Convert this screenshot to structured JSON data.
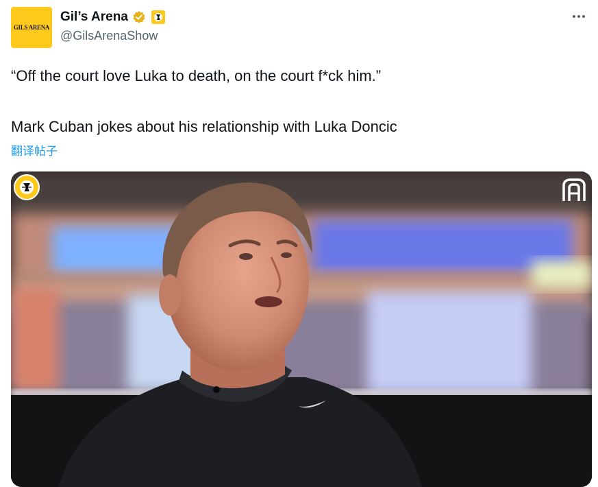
{
  "account": {
    "display_name": "Gil’s Arena",
    "handle": "@GilsArenaShow",
    "avatar_text": "GILS ARENA",
    "verified_color": "#e8b21c",
    "affiliate_badge": "gils-arena-badge-icon"
  },
  "tweet": {
    "quote": "“Off the court love Luka to death, on the court f*ck him.”",
    "body": "Mark Cuban jokes about his relationship with Luka Doncic",
    "translate_label": "翻译帖子"
  },
  "media": {
    "type": "video-thumbnail",
    "channel_badge": "gils-arena-channel-icon",
    "brand_mark": "brand-logo-icon"
  },
  "colors": {
    "accent": "#ffc91c",
    "link": "#1d9bf0",
    "secondary_text": "#536471"
  }
}
